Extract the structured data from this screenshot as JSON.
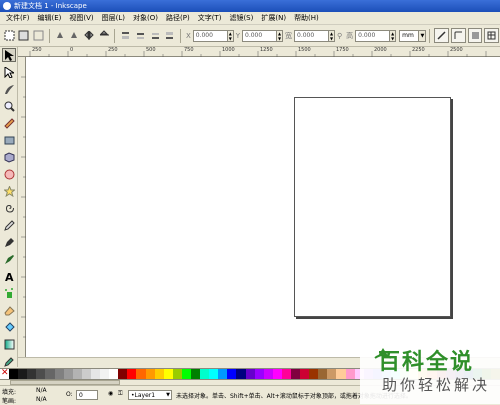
{
  "window": {
    "title": "新建文档 1 - Inkscape"
  },
  "menu": [
    "文件(F)",
    "编辑(E)",
    "视图(V)",
    "图层(L)",
    "对象(O)",
    "路径(P)",
    "文字(T)",
    "滤镜(S)",
    "扩展(N)",
    "帮助(H)"
  ],
  "toolbar": {
    "x_label": "X",
    "x_value": "0.000",
    "y_label": "Y",
    "y_value": "0.000",
    "w_label": "宽",
    "w_value": "0.000",
    "h_label": "高",
    "h_value": "0.000",
    "unit": "mm"
  },
  "ruler": {
    "ticks": [
      "250",
      "0",
      "250",
      "500",
      "750",
      "1000",
      "1250",
      "1500",
      "1750",
      "2000",
      "2250",
      "2500"
    ]
  },
  "tools": [
    "selector-icon",
    "node-icon",
    "tweak-icon",
    "zoom-icon",
    "measure-icon",
    "rect-icon",
    "3dbox-icon",
    "ellipse-icon",
    "star-icon",
    "spiral-icon",
    "pencil-icon",
    "pen-icon",
    "calligraphy-icon",
    "text-icon",
    "spray-icon",
    "eraser-icon",
    "paint-bucket-icon",
    "gradient-icon",
    "dropper-icon"
  ],
  "palette": [
    "#000000",
    "#1a1a1a",
    "#333333",
    "#4d4d4d",
    "#666666",
    "#808080",
    "#999999",
    "#b3b3b3",
    "#cccccc",
    "#e6e6e6",
    "#f2f2f2",
    "#ffffff",
    "#800000",
    "#ff0000",
    "#ff6600",
    "#ff9900",
    "#ffcc00",
    "#ffff00",
    "#99cc00",
    "#00ff00",
    "#008000",
    "#00ffcc",
    "#00ffff",
    "#0099ff",
    "#0000ff",
    "#000080",
    "#6600cc",
    "#9900ff",
    "#cc00ff",
    "#ff00ff",
    "#ff0099",
    "#800040",
    "#cc0033",
    "#993300",
    "#996633",
    "#cc9966",
    "#ffcc99",
    "#ff99cc",
    "#ffccff",
    "#cc99ff",
    "#9999ff",
    "#99ccff",
    "#99ffff",
    "#ccffcc",
    "#ffffcc",
    "#ffcc66",
    "#ff9966",
    "#cc6666",
    "#996699",
    "#666699",
    "#336699",
    "#339966",
    "#669933",
    "#999933"
  ],
  "status": {
    "fill_label": "填充:",
    "fill_value": "N/A",
    "stroke_label": "笔画:",
    "stroke_value": "N/A",
    "opacity_label": "O:",
    "opacity_value": "0",
    "layer": "•Layer1",
    "message": "未选择对象。单击、Shift+单击、Alt+滚动鼠标于对象顶部，或拖着对象拖动进行选择。"
  },
  "watermark": {
    "title": "百科全说",
    "subtitle": "助你轻松解决"
  }
}
